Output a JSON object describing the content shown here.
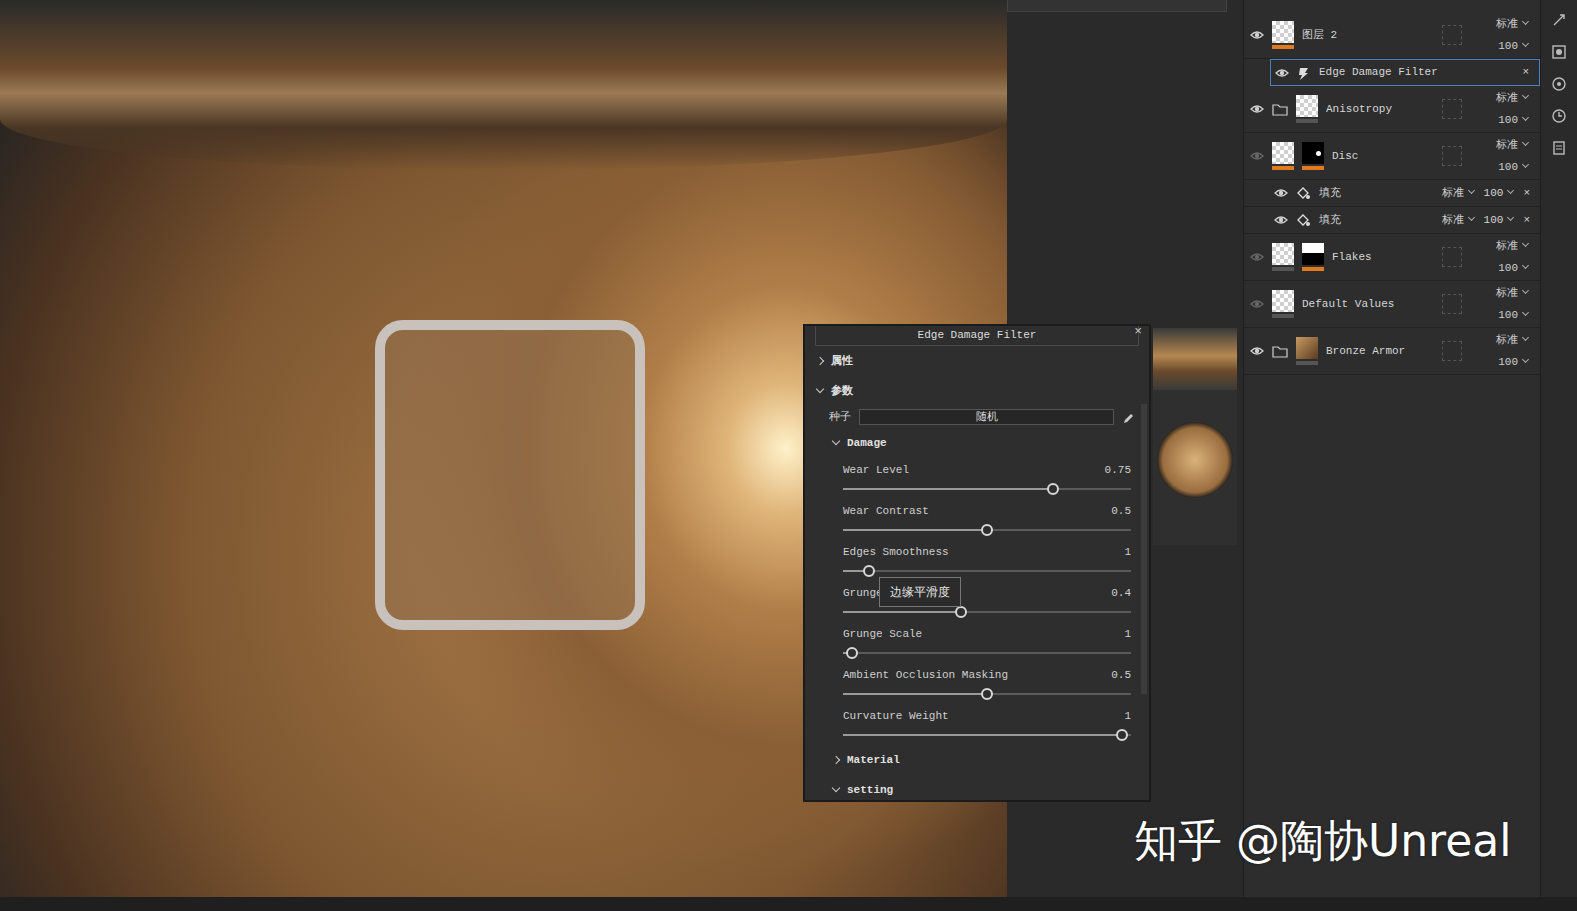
{
  "viewport": {
    "watermark": "知乎 @陶协Unreal"
  },
  "filter_panel": {
    "title": "Edge Damage Filter",
    "close": "×",
    "sections": [
      {
        "label": "属性",
        "expanded": false
      },
      {
        "label": "参数",
        "expanded": true
      }
    ],
    "seed": {
      "label": "种子",
      "value": "随机"
    },
    "group": {
      "label": "Damage",
      "expanded": true
    },
    "sliders": [
      {
        "label": "Wear Level",
        "value": "0.75",
        "level": 0.73
      },
      {
        "label": "Wear Contrast",
        "value": "0.5",
        "level": 0.5
      },
      {
        "label": "Edges Smoothness",
        "value": "1",
        "level": 0.09
      },
      {
        "label": "Grunge",
        "value": "0.4",
        "level": 0.41
      },
      {
        "label": "Grunge Scale",
        "value": "1",
        "level": 0.03
      },
      {
        "label": "Ambient Occlusion Masking",
        "value": "0.5",
        "level": 0.5
      },
      {
        "label": "Curvature Weight",
        "value": "1",
        "level": 0.97
      }
    ],
    "tooltip": "边缘平滑度",
    "after_sections": [
      {
        "label": "Material",
        "expanded": false
      },
      {
        "label": "setting",
        "expanded": true
      }
    ]
  },
  "layers": [
    {
      "name": "图层 2",
      "kind": "layer",
      "visible": true,
      "thumb": "checker",
      "mask": "none",
      "thumb_marked": true,
      "mask_marked": false,
      "blend": "标准",
      "opacity": "100",
      "children": [
        {
          "name": "Edge Damage Filter",
          "kind": "filter",
          "selected": true,
          "visible": true,
          "close": "×"
        }
      ]
    },
    {
      "name": "Anisotropy",
      "kind": "folder",
      "visible": true,
      "thumb": "checker",
      "mask": "none",
      "thumb_marked": false,
      "mask_marked": false,
      "blend": "标准",
      "opacity": "100",
      "children": []
    },
    {
      "name": "Disc",
      "kind": "layer",
      "visible": false,
      "thumb": "checker",
      "mask": "dot",
      "thumb_marked": true,
      "mask_marked": true,
      "blend": "标准",
      "opacity": "100",
      "children": [
        {
          "name": "填充",
          "kind": "fill",
          "selected": false,
          "visible": true,
          "blend": "标准",
          "opacity": "100",
          "close": "×"
        },
        {
          "name": "填充",
          "kind": "fill",
          "selected": false,
          "visible": true,
          "blend": "标准",
          "opacity": "100",
          "close": "×"
        }
      ]
    },
    {
      "name": "Flakes",
      "kind": "layer",
      "visible": false,
      "thumb": "checker",
      "mask": "split",
      "thumb_marked": false,
      "mask_marked": true,
      "blend": "标准",
      "opacity": "100",
      "children": []
    },
    {
      "name": "Default Values",
      "kind": "layer",
      "visible": false,
      "thumb": "checker",
      "mask": "none",
      "thumb_marked": false,
      "mask_marked": false,
      "blend": "标准",
      "opacity": "100",
      "children": []
    },
    {
      "name": "Bronze Armor",
      "kind": "folder",
      "visible": true,
      "thumb": "bronze",
      "mask": "none",
      "thumb_marked": false,
      "mask_marked": false,
      "blend": "标准",
      "opacity": "100",
      "children": []
    }
  ]
}
